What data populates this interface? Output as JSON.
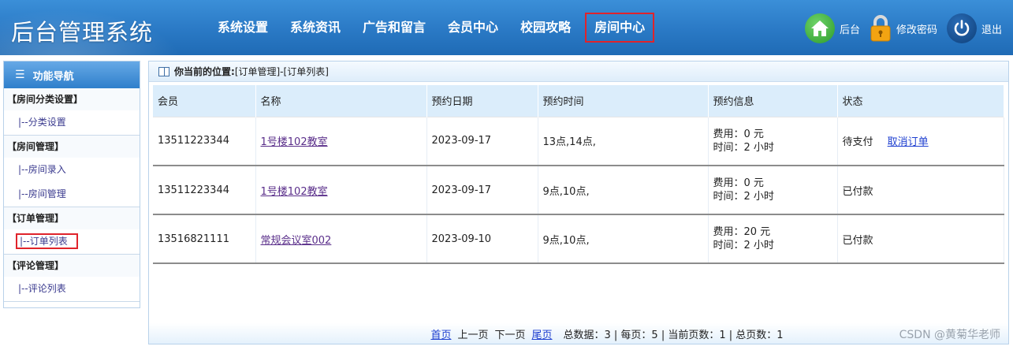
{
  "app_title": "后台管理系统",
  "topnav": {
    "items": [
      "系统设置",
      "系统资讯",
      "广告和留言",
      "会员中心",
      "校园攻略"
    ],
    "active": "房间中心"
  },
  "header_actions": {
    "home": "后台",
    "change_password": "修改密码",
    "logout": "退出"
  },
  "sidebar": {
    "title": "功能导航",
    "groups": [
      {
        "title": "【房间分类设置】",
        "items": [
          "|--分类设置"
        ]
      },
      {
        "title": "【房间管理】",
        "items": [
          "|--房间录入",
          "|--房间管理"
        ]
      },
      {
        "title": "【订单管理】",
        "items": [
          "|--订单列表"
        ]
      },
      {
        "title": "【评论管理】",
        "items": [
          "|--评论列表"
        ]
      }
    ]
  },
  "breadcrumb": {
    "label": "你当前的位置:",
    "path": "[订单管理]-[订单列表]"
  },
  "table": {
    "headers": [
      "会员",
      "名称",
      "预约日期",
      "预约时间",
      "预约信息",
      "状态"
    ],
    "rows": [
      {
        "member": "13511223344",
        "name": "1号楼102教室",
        "date": "2023-09-17",
        "time": "13点,14点,",
        "fee": "费用：0 元",
        "duration": "时间：2 小时",
        "status": "待支付",
        "action": "取消订单"
      },
      {
        "member": "13511223344",
        "name": "1号楼102教室",
        "date": "2023-09-17",
        "time": "9点,10点,",
        "fee": "费用：0 元",
        "duration": "时间：2 小时",
        "status": "已付款",
        "action": ""
      },
      {
        "member": "13516821111",
        "name": "常规会议室002",
        "date": "2023-09-10",
        "time": "9点,10点,",
        "fee": "费用：20 元",
        "duration": "时间：2 小时",
        "status": "已付款",
        "action": ""
      }
    ]
  },
  "pager": {
    "first": "首页",
    "prev": "上一页",
    "next": "下一页",
    "last": "尾页",
    "summary": "总数据：3 | 每页：5 | 当前页数：1 | 总页数：1"
  },
  "watermark": "CSDN @黄菊华老师",
  "colors": {
    "header": "#2a79c5",
    "highlight_border": "#e0232b",
    "table_header": "#dbedfb"
  }
}
